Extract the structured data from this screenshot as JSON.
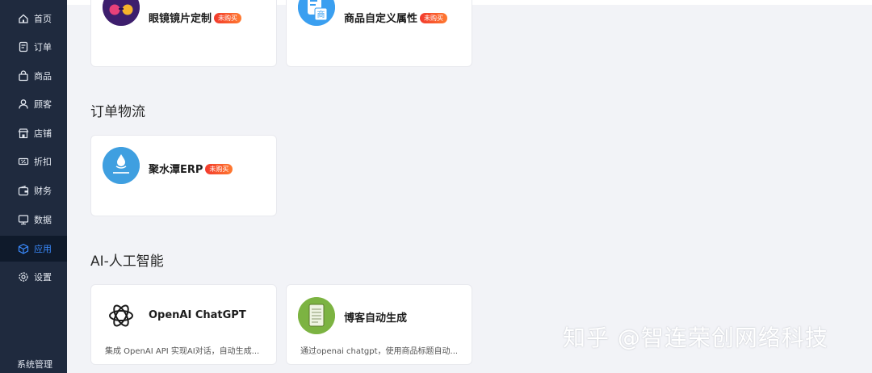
{
  "sidebar": {
    "items": [
      {
        "label": "首页",
        "icon": "home-icon"
      },
      {
        "label": "订单",
        "icon": "order-icon"
      },
      {
        "label": "商品",
        "icon": "bag-icon"
      },
      {
        "label": "顾客",
        "icon": "user-icon"
      },
      {
        "label": "店铺",
        "icon": "store-icon"
      },
      {
        "label": "折扣",
        "icon": "discount-icon"
      },
      {
        "label": "财务",
        "icon": "wallet-icon"
      },
      {
        "label": "数据",
        "icon": "monitor-icon"
      },
      {
        "label": "应用",
        "icon": "cube-icon",
        "active": true
      },
      {
        "label": "设置",
        "icon": "gear-icon"
      }
    ],
    "system_link": "系统管理",
    "colors": {
      "background": "#1f2a3e",
      "active_background": "#0f1a2b",
      "active_text": "#3a8bff"
    }
  },
  "apps_top": [
    {
      "title": "眼镜镜片定制",
      "badge": "未购买",
      "icon": "glasses-icon"
    },
    {
      "title": "商品自定义属性",
      "badge": "未购买",
      "icon": "product-attribute-icon"
    }
  ],
  "sections": [
    {
      "title": "订单物流",
      "apps": [
        {
          "title": "聚水潭ERP",
          "badge": "未购买",
          "icon": "jushuitan-logo-icon"
        }
      ]
    },
    {
      "title": "AI-人工智能",
      "apps": [
        {
          "title": "OpenAI ChatGPT",
          "desc": "集成 OpenAI API 实现AI对话，自动生成...",
          "icon": "openai-icon"
        },
        {
          "title": "博客自动生成",
          "desc": "通过openai chatgpt，使用商品标题自动...",
          "icon": "notepad-icon"
        }
      ]
    }
  ],
  "watermark": "知乎 @智连荣创网络科技",
  "colors": {
    "badge_start": "#f23a2d",
    "badge_end": "#ff7a30",
    "page_background": "#f2f3f7"
  }
}
